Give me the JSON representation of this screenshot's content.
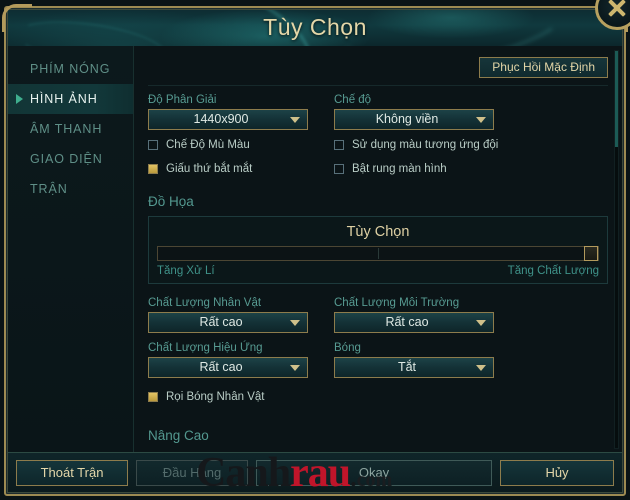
{
  "window": {
    "title": "Tùy Chọn",
    "close_icon": "close-icon"
  },
  "sidebar": {
    "items": [
      {
        "label": "PHÍM NÓNG",
        "active": false
      },
      {
        "label": "HÌNH ẢNH",
        "active": true
      },
      {
        "label": "ÂM THANH",
        "active": false
      },
      {
        "label": "GIAO DIỆN",
        "active": false
      },
      {
        "label": "TRẬN",
        "active": false
      }
    ]
  },
  "main": {
    "reset_button": "Phục Hồi Mặc Định",
    "resolution": {
      "label": "Độ Phân Giải",
      "value": "1440x900"
    },
    "mode": {
      "label": "Chế độ",
      "value": "Không viền"
    },
    "checkboxes_left": [
      {
        "label": "Chế Độ Mù Màu",
        "checked": false
      },
      {
        "label": "Giấu thứ bắt mắt",
        "checked": true
      }
    ],
    "checkboxes_right": [
      {
        "label": "Sử dụng màu tương ứng đội",
        "checked": false
      },
      {
        "label": "Bật rung màn hình",
        "checked": false
      }
    ],
    "graphics": {
      "section_title": "Đồ Họa",
      "preset_title": "Tùy Chọn",
      "slider_left_label": "Tăng Xử Lí",
      "slider_right_label": "Tăng Chất Lượng",
      "slider_percent": 100
    },
    "quality": {
      "character": {
        "label": "Chất Lượng Nhân Vật",
        "value": "Rất cao"
      },
      "environment": {
        "label": "Chất Lượng Môi Trường",
        "value": "Rất cao"
      },
      "effects": {
        "label": "Chất Lượng Hiệu Ứng",
        "value": "Rất cao"
      },
      "shadows": {
        "label": "Bóng",
        "value": "Tắt"
      }
    },
    "character_shadow": {
      "label": "Rọi Bóng Nhân Vật",
      "checked": true
    },
    "advanced_title": "Nâng Cao"
  },
  "bottom_bar": {
    "exit_match": "Thoát Trận",
    "surrender": "Đầu Hàng",
    "okay": "Okay",
    "cancel": "Hủy"
  },
  "watermark": {
    "part1": "Canh",
    "part2": "rau",
    "dot": ".",
    "part3": "com"
  },
  "colors": {
    "gold": "#b39a5c",
    "teal": "#1c5b56",
    "accent_text": "#e4d7a8",
    "label_teal": "#53988f",
    "checked_gold": "#e3c464",
    "watermark_red": "#c0152a"
  }
}
